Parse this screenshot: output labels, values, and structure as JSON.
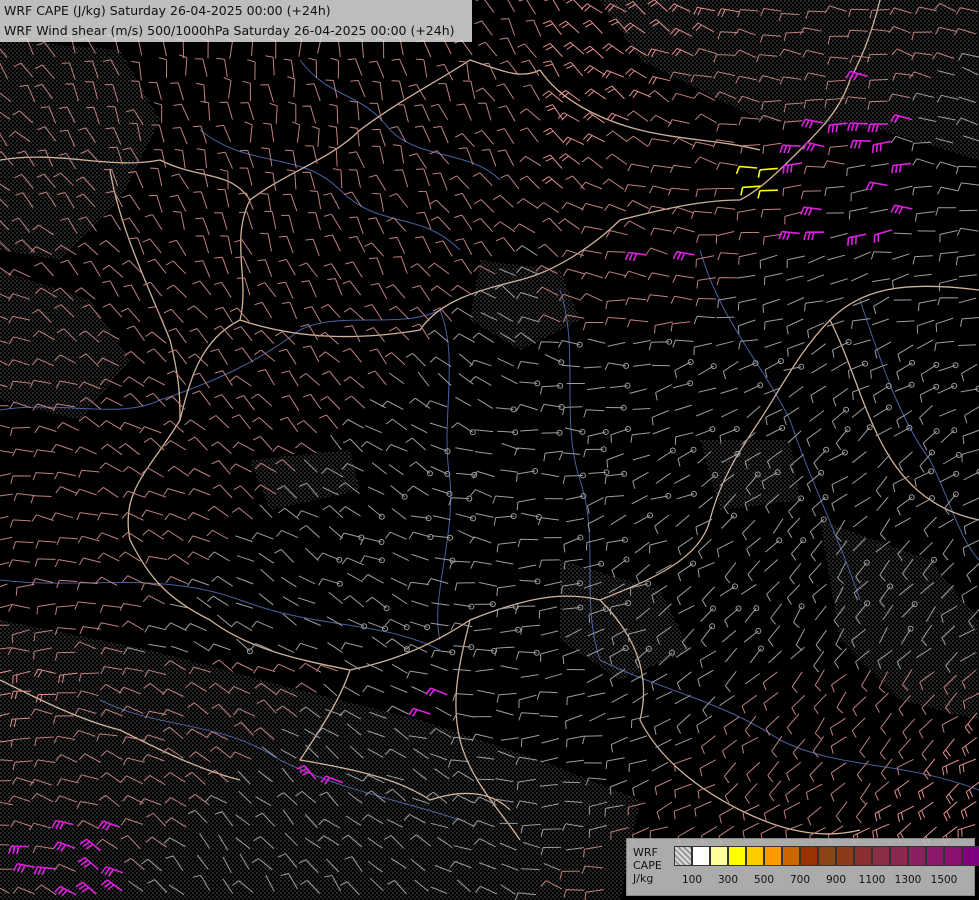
{
  "titles": {
    "line1": "WRF CAPE (J/kg) Saturday 26-04-2025 00:00 (+24h)",
    "line2": "WRF Wind shear (m/s) 500/1000hPa Saturday 26-04-2025 00:00 (+24h)"
  },
  "legend": {
    "label_line1": "WRF",
    "label_line2": "CAPE",
    "label_line3": "J/kg",
    "colors": [
      "#cccccc",
      "#ffffff",
      "#ffff99",
      "#ffff00",
      "#ffcc00",
      "#ff9900",
      "#cc6600",
      "#993300",
      "#8b4513",
      "#8b3a1a",
      "#8b3030",
      "#8b2f45",
      "#8b2850",
      "#8b2060",
      "#8b1a6a",
      "#8b1070",
      "#800080"
    ],
    "ticks": [
      {
        "label": "100",
        "index": 1
      },
      {
        "label": "300",
        "index": 3
      },
      {
        "label": "500",
        "index": 5
      },
      {
        "label": "700",
        "index": 7
      },
      {
        "label": "900",
        "index": 9
      },
      {
        "label": "1100",
        "index": 11
      },
      {
        "label": "1300",
        "index": 13
      },
      {
        "label": "1500",
        "index": 15
      }
    ]
  },
  "map_colors": {
    "background": "#000000",
    "border": "#f5d2b4",
    "river": "#5a78c8",
    "barb_weak": "#9e9e9e",
    "barb_mid": "#c08080",
    "barb_strong": "#e89090",
    "cape_high": "#e020e0",
    "cape_yellow": "#ffff00"
  }
}
